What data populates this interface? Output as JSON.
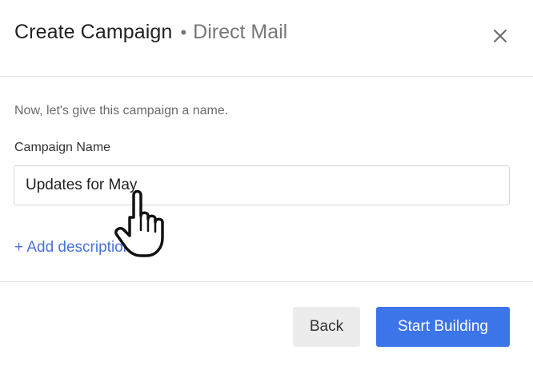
{
  "header": {
    "title": "Create Campaign",
    "separator": "•",
    "subtitle": "Direct Mail",
    "close_icon": "close-icon"
  },
  "body": {
    "intro": "Now, let's give this campaign a name.",
    "campaign_name_label": "Campaign Name",
    "campaign_name_value": "Updates for May",
    "add_description": "+ Add description"
  },
  "footer": {
    "back_label": "Back",
    "start_label": "Start Building"
  },
  "colors": {
    "primary": "#3c74ea",
    "link": "#4a72d9",
    "secondary_button": "#ececec"
  },
  "cursor": {
    "icon": "hand-pointer-icon"
  }
}
